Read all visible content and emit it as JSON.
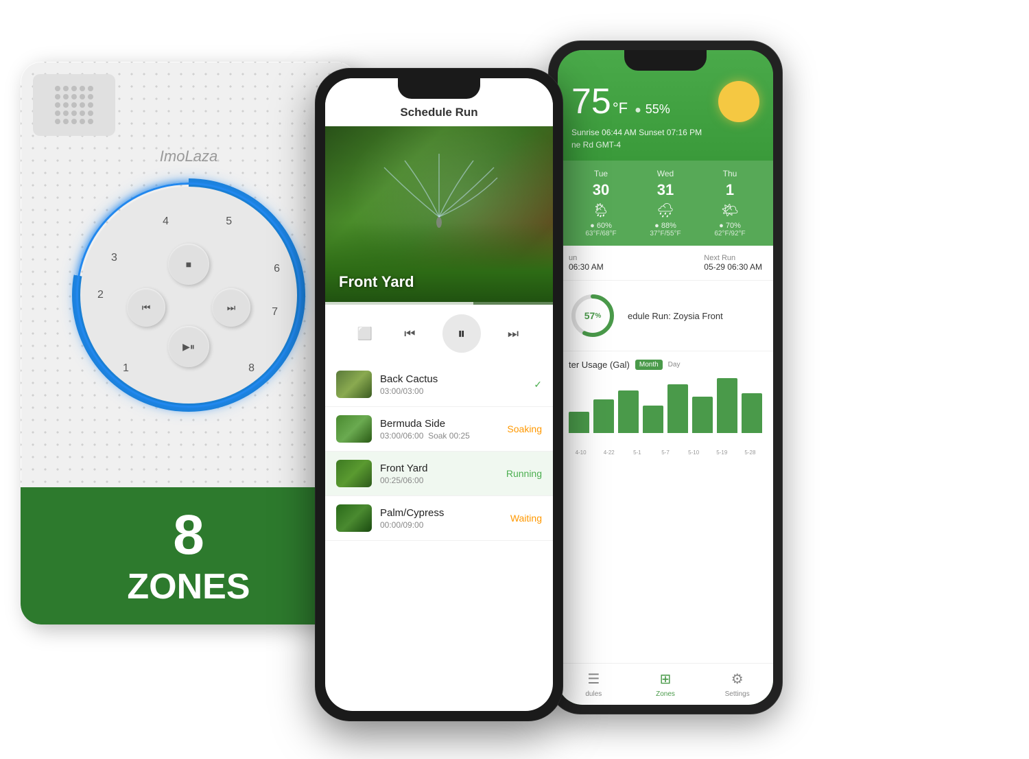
{
  "brand": "ImoLaza",
  "device": {
    "zones_number": "8",
    "zones_label": "ZONES"
  },
  "phone_front": {
    "title": "Schedule Run",
    "yard_label": "Front Yard",
    "controls": {
      "stop": "■",
      "prev": "⏮",
      "play_pause": "⏸",
      "next": "⏭"
    },
    "zones": [
      {
        "name": "Back Cactus",
        "time": "03:00/03:00",
        "status": "✓",
        "status_type": "done",
        "soak": ""
      },
      {
        "name": "Bermuda Side",
        "time": "03:00/06:00",
        "status": "Soaking",
        "status_type": "soaking",
        "soak": "Soak 00:25"
      },
      {
        "name": "Front Yard",
        "time": "00:25/06:00",
        "status": "Running",
        "status_type": "running",
        "soak": ""
      },
      {
        "name": "Palm/Cypress",
        "time": "00:00/09:00",
        "status": "Waiting",
        "status_type": "waiting",
        "soak": ""
      }
    ]
  },
  "phone_back": {
    "temperature": "75",
    "temp_unit": "°F",
    "humidity": "55%",
    "sunrise": "06:44 AM",
    "sunset": "07:16 PM",
    "location": "ne Rd GMT-4",
    "forecast": [
      {
        "day": "Tue",
        "date": "30",
        "icon": "🌦",
        "pct": "● 60%",
        "temps": "63°F/68°F"
      },
      {
        "day": "Wed",
        "date": "31",
        "icon": "🌧",
        "pct": "● 88%",
        "temps": "37°F/55°F"
      },
      {
        "day": "Thu",
        "date": "1",
        "icon": "🌤",
        "pct": "● 70%",
        "temps": "62°F/92°F"
      }
    ],
    "last_run_label": "un",
    "last_run_time": "06:30 AM",
    "next_run_label": "Next Run",
    "next_run_time": "05-29 06:30 AM",
    "progress_pct": "57",
    "schedule_name": "edule Run: Zoysia Front",
    "water_usage_title": "ter Usage (Gal)",
    "month_btn": "Month",
    "day_btn": "Day",
    "chart_bars": [
      35,
      55,
      70,
      45,
      80,
      60,
      90,
      65
    ],
    "chart_dates": [
      "4-10",
      "4-22",
      "5-1",
      "5-7",
      "5-10",
      "5-19",
      "5-28"
    ],
    "nav": [
      {
        "label": "dules",
        "icon": "☰",
        "active": false
      },
      {
        "label": "Zones",
        "icon": "⊞",
        "active": true
      },
      {
        "label": "Settings",
        "icon": "⚙",
        "active": false
      }
    ]
  }
}
